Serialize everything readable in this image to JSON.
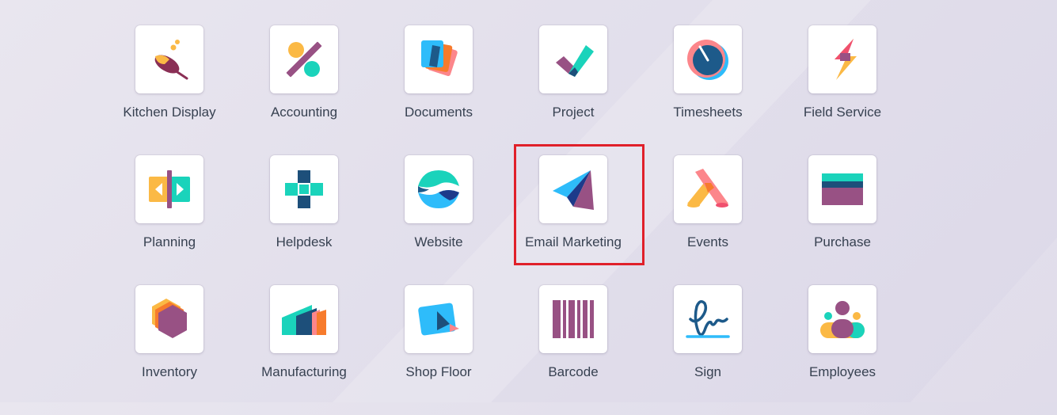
{
  "apps": [
    {
      "label": "Kitchen Display",
      "icon": "kitchen-display-icon"
    },
    {
      "label": "Accounting",
      "icon": "accounting-icon"
    },
    {
      "label": "Documents",
      "icon": "documents-icon"
    },
    {
      "label": "Project",
      "icon": "project-icon"
    },
    {
      "label": "Timesheets",
      "icon": "timesheets-icon"
    },
    {
      "label": "Field Service",
      "icon": "field-service-icon"
    },
    {
      "label": "Planning",
      "icon": "planning-icon"
    },
    {
      "label": "Helpdesk",
      "icon": "helpdesk-icon"
    },
    {
      "label": "Website",
      "icon": "website-icon"
    },
    {
      "label": "Email Marketing",
      "icon": "email-marketing-icon"
    },
    {
      "label": "Events",
      "icon": "events-icon"
    },
    {
      "label": "Purchase",
      "icon": "purchase-icon"
    },
    {
      "label": "Inventory",
      "icon": "inventory-icon"
    },
    {
      "label": "Manufacturing",
      "icon": "manufacturing-icon"
    },
    {
      "label": "Shop Floor",
      "icon": "shop-floor-icon"
    },
    {
      "label": "Barcode",
      "icon": "barcode-icon"
    },
    {
      "label": "Sign",
      "icon": "sign-icon"
    },
    {
      "label": "Employees",
      "icon": "employees-icon"
    }
  ],
  "highlighted_app": "Email Marketing",
  "colors": {
    "highlight_border": "#e0202a",
    "purple": "#985184",
    "teal": "#1ad3bb",
    "blue": "#2ebcfa",
    "orange": "#fc868b",
    "yellow": "#fbb945",
    "dark_teal": "#005e7a"
  }
}
